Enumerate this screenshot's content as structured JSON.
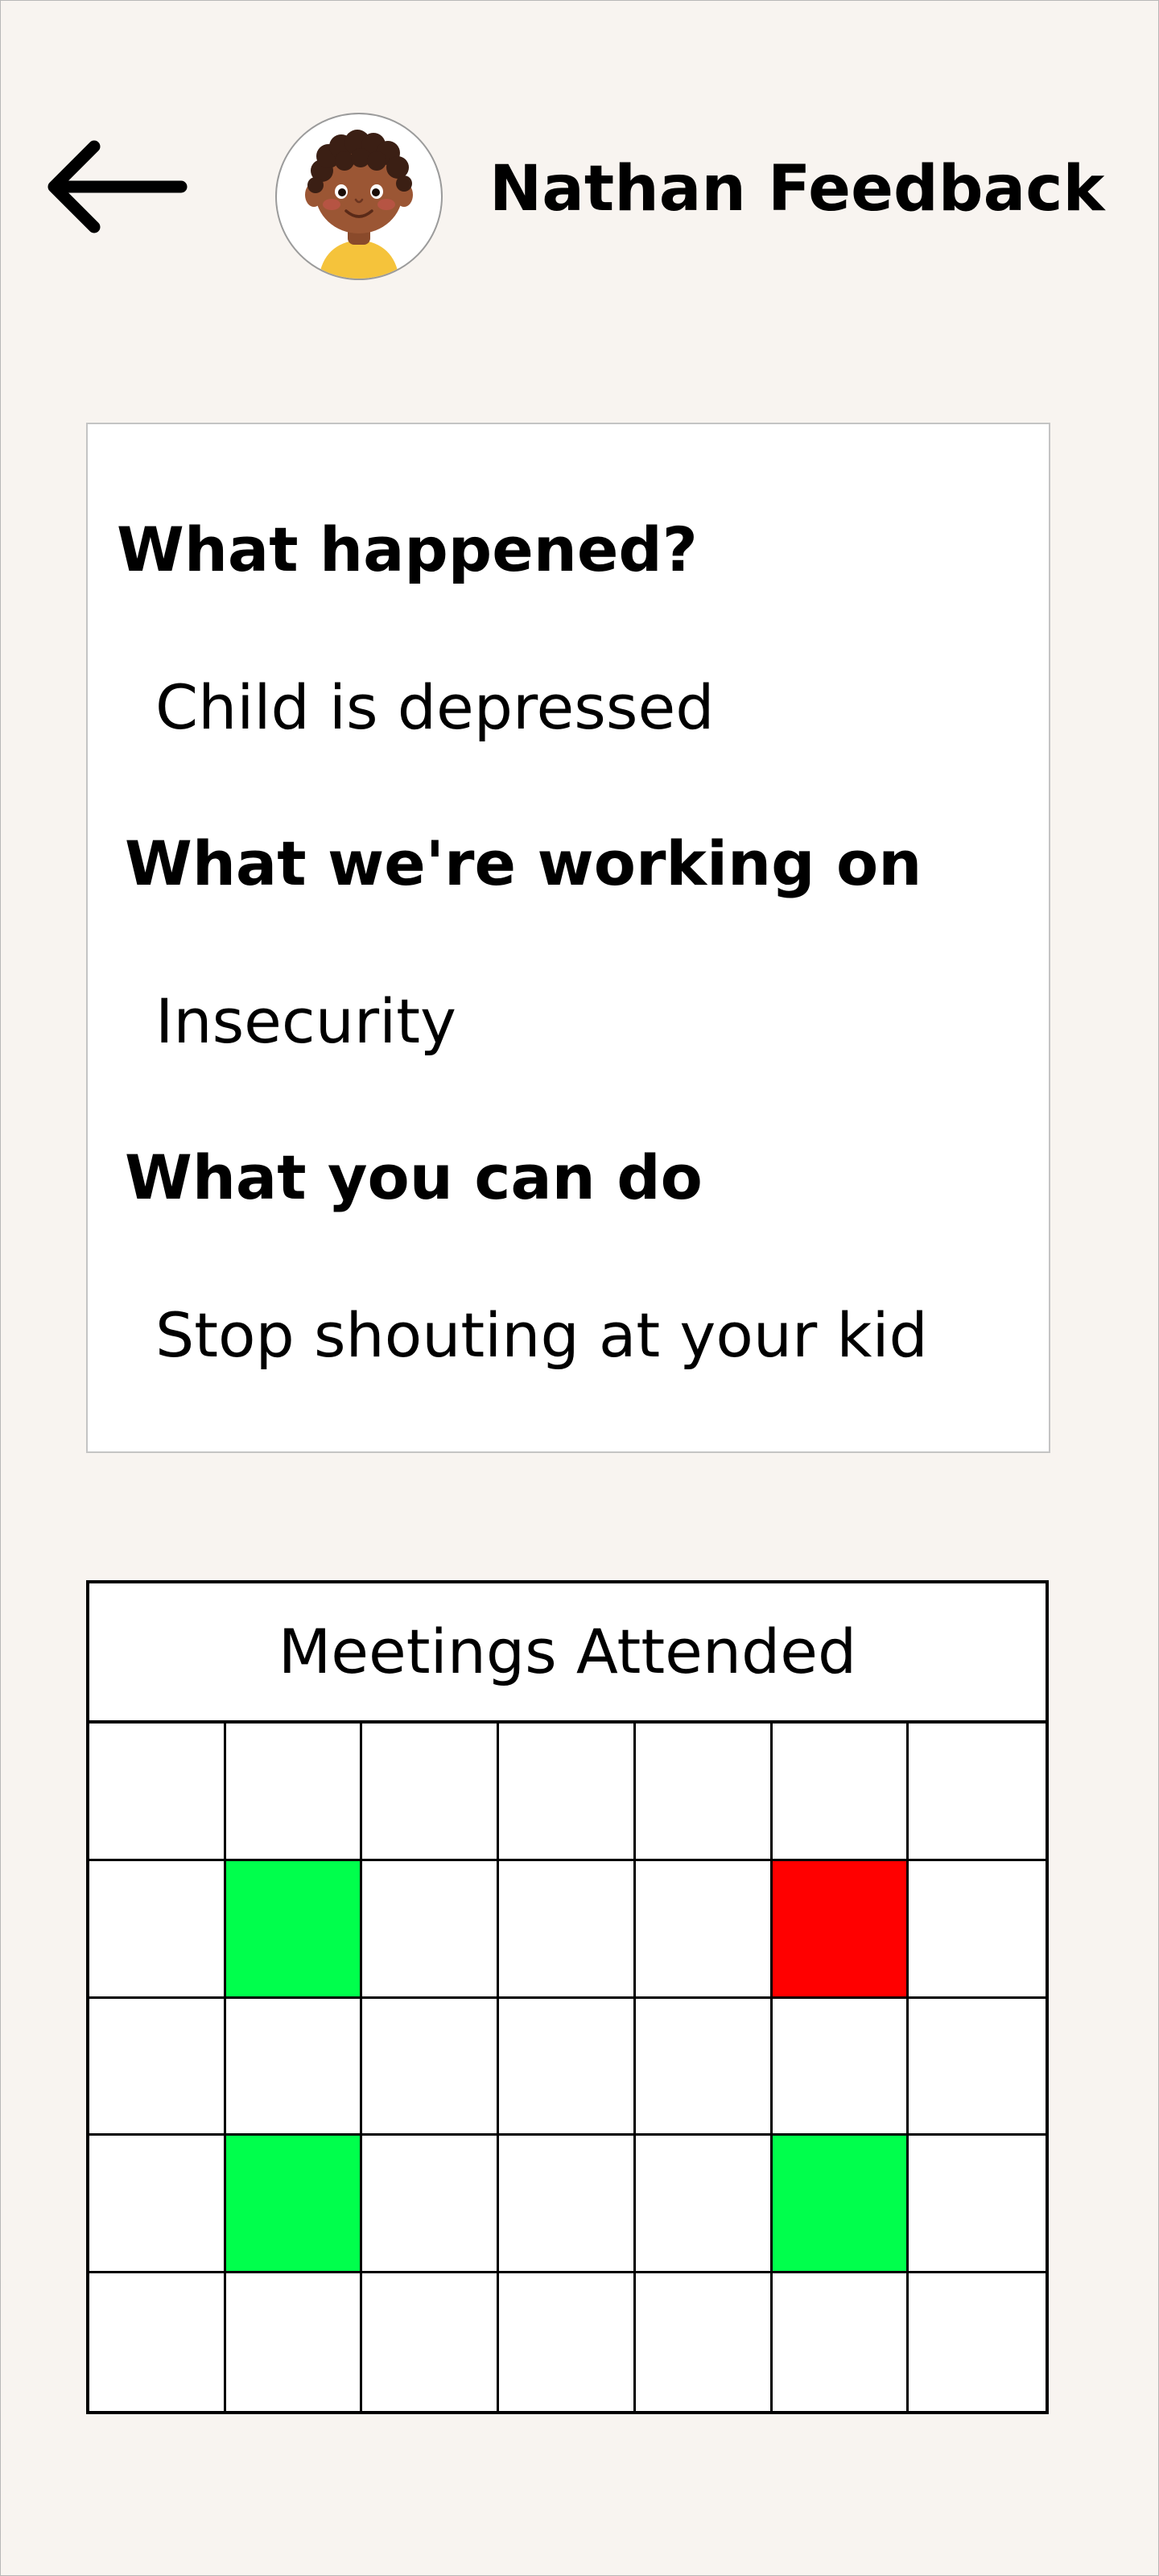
{
  "header": {
    "title": "Nathan Feedback",
    "back_icon": "arrow-left-icon",
    "avatar_icon": "child-avatar"
  },
  "feedback": {
    "sections": [
      {
        "heading": "What happened?",
        "answer": "Child is depressed"
      },
      {
        "heading": "What we're working on",
        "answer": "Insecurity"
      },
      {
        "heading": "What you can do",
        "answer": "Stop shouting at your kid"
      }
    ]
  },
  "meetings": {
    "title": "Meetings Attended",
    "rows": 5,
    "columns": 7,
    "status_colors": {
      "attended": "#00ff4c",
      "missed": "#ff0000",
      "none": "#ffffff"
    },
    "cells": [
      [
        "none",
        "none",
        "none",
        "none",
        "none",
        "none",
        "none"
      ],
      [
        "none",
        "attended",
        "none",
        "none",
        "none",
        "missed",
        "none"
      ],
      [
        "none",
        "none",
        "none",
        "none",
        "none",
        "none",
        "none"
      ],
      [
        "none",
        "attended",
        "none",
        "none",
        "none",
        "attended",
        "none"
      ],
      [
        "none",
        "none",
        "none",
        "none",
        "none",
        "none",
        "none"
      ]
    ]
  }
}
